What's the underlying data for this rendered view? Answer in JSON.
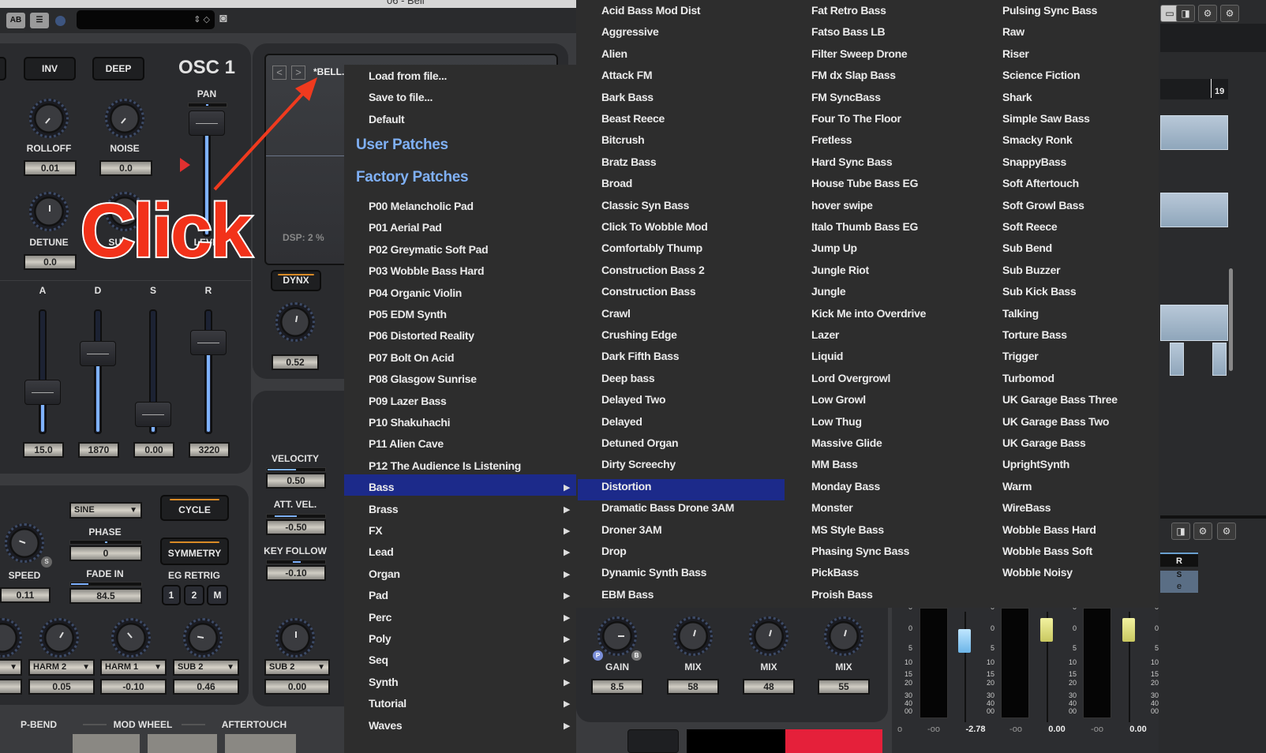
{
  "window": {
    "title": "06 - Bell"
  },
  "toolbar": {
    "ab_label": "AB",
    "list_icon": "list-icon",
    "camera_icon": "camera-icon",
    "field_arrows": "⇕ ◇"
  },
  "osc": {
    "title": "OSC 1",
    "inv": "INV",
    "deep": "DEEP",
    "pan": "PAN",
    "knobs": [
      {
        "label": "ROLLOFF",
        "value": "0.01"
      },
      {
        "label": "NOISE",
        "value": "0.0"
      },
      {
        "label": "DETUNE",
        "value": "0.0"
      },
      {
        "label": "SUB",
        "value": ""
      }
    ],
    "level_label": "LEVEL"
  },
  "env": {
    "labels": [
      "A",
      "D",
      "S",
      "R"
    ],
    "values": [
      "15.0",
      "1870",
      "0.00",
      "3220"
    ],
    "levels": [
      0.25,
      0.6,
      0.05,
      0.7
    ]
  },
  "display": {
    "prev": "<",
    "next": ">",
    "patch_name": "*BELL.B",
    "dsp": "DSP: 2 %"
  },
  "dynx": {
    "label": "DYNX",
    "value": "0.52"
  },
  "mod": {
    "velocity_label": "VELOCITY",
    "velocity": "0.50",
    "att_vel_label": "ATT. VEL.",
    "att_vel": "-0.50",
    "key_follow_label": "KEY FOLLOW",
    "key_follow": "-0.10",
    "sub_dd": "SUB 2",
    "sub_val": "0.00"
  },
  "lfo": {
    "wave": "SINE",
    "phase_label": "PHASE",
    "phase": "0",
    "fade_label": "FADE IN",
    "fade": "84.5",
    "cycle": "CYCLE",
    "symmetry": "SYMMETRY",
    "eg_label": "EG RETRIG",
    "eg": [
      "1",
      "2",
      "M"
    ],
    "speed_label": "SPEED",
    "speed": "0.11",
    "s_badge": "S"
  },
  "harm": [
    {
      "dd": "HARM 2",
      "value": "0.05"
    },
    {
      "dd": "HARM 1",
      "value": "-0.10"
    },
    {
      "dd": "SUB 2",
      "value": "0.46"
    }
  ],
  "controllers": [
    "P-BEND",
    "MOD WHEEL",
    "AFTERTOUCH"
  ],
  "fx": [
    {
      "label": "GAIN",
      "value": "8.5"
    },
    {
      "label": "MIX",
      "value": "58"
    },
    {
      "label": "MIX",
      "value": "48"
    },
    {
      "label": "MIX",
      "value": "55"
    }
  ],
  "fx_badges": [
    "P",
    "B"
  ],
  "mixer": {
    "readouts": [
      "o",
      "-oo",
      "-2.78",
      "-oo",
      "0.00",
      "-oo",
      "0.00",
      "-oo"
    ],
    "scale": [
      "0",
      "0",
      "5",
      "10",
      "15",
      "20",
      "30",
      "40",
      "00"
    ]
  },
  "right": {
    "ruler": "19",
    "r": "R",
    "s": "S",
    "e": "e"
  },
  "annotation": {
    "text": "Click"
  },
  "menu": {
    "file_items": [
      "Load from file...",
      "Save to file...",
      "Default"
    ],
    "user_header": "User Patches",
    "factory_header": "Factory Patches",
    "patches": [
      "P00 Melancholic Pad",
      "P01 Aerial Pad",
      "P02 Greymatic Soft Pad",
      "P03 Wobble Bass Hard",
      "P04 Organic Violin",
      "P05 EDM Synth",
      "P06 Distorted Reality",
      "P07 Bolt On Acid",
      "P08 Glasgow Sunrise",
      "P09 Lazer Bass",
      "P10 Shakuhachi",
      "P11 Alien Cave",
      "P12 The Audience Is Listening"
    ],
    "categories": [
      "Bass",
      "Brass",
      "FX",
      "Lead",
      "Organ",
      "Pad",
      "Perc",
      "Poly",
      "Seq",
      "Synth",
      "Tutorial",
      "Waves"
    ],
    "selected_category": "Bass",
    "bass_columns": [
      [
        "Acid Bass Mod Dist",
        "Aggressive",
        "Alien",
        "Attack FM",
        "Bark Bass",
        "Beast Reece",
        "Bitcrush",
        "Bratz Bass",
        "Broad",
        "Classic Syn Bass",
        "Click To Wobble Mod",
        "Comfortably Thump",
        "Construction Bass 2",
        "Construction Bass",
        "Crawl",
        "Crushing Edge",
        "Dark Fifth Bass",
        "Deep bass",
        "Delayed Two",
        "Delayed",
        "Detuned Organ",
        "Dirty Screechy",
        "Distortion",
        "Dramatic Bass Drone 3AM",
        "Droner 3AM",
        "Drop",
        "Dynamic Synth Bass",
        "EBM Bass"
      ],
      [
        "Fat Retro Bass",
        "Fatso Bass LB",
        "Filter Sweep Drone",
        "FM dx Slap Bass",
        "FM SyncBass",
        "Four To The Floor",
        "Fretless",
        "Hard Sync Bass",
        "House Tube Bass EG",
        "hover swipe",
        "Italo Thumb Bass EG",
        "Jump Up",
        "Jungle Riot",
        "Jungle",
        "Kick Me into Overdrive",
        "Lazer",
        "Liquid",
        "Lord Overgrowl",
        "Low Growl",
        "Low Thug",
        "Massive Glide",
        "MM Bass",
        "Monday Bass",
        "Monster",
        "MS Style Bass",
        "Phasing Sync Bass",
        "PickBass",
        "Proish Bass"
      ],
      [
        "Pulsing Sync Bass",
        "Raw",
        "Riser",
        "Science Fiction",
        "Shark",
        "Simple Saw Bass",
        "Smacky Ronk",
        "SnappyBass",
        "Soft Aftertouch",
        "Soft Growl Bass",
        "Soft Reece",
        "Sub Bend",
        "Sub Buzzer",
        "Sub Kick Bass",
        "Talking",
        "Torture Bass",
        "Trigger",
        "Turbomod",
        "UK Garage Bass Three",
        "UK Garage Bass Two",
        "UK Garage Bass",
        "UprightSynth",
        "Warm",
        "WireBass",
        "Wobble Bass Hard",
        "Wobble Bass Soft",
        "Wobble Noisy"
      ]
    ],
    "selected_patch": "Distortion",
    "highlight_color": "#1c2a8a",
    "header_color": "#7fb0f5"
  }
}
